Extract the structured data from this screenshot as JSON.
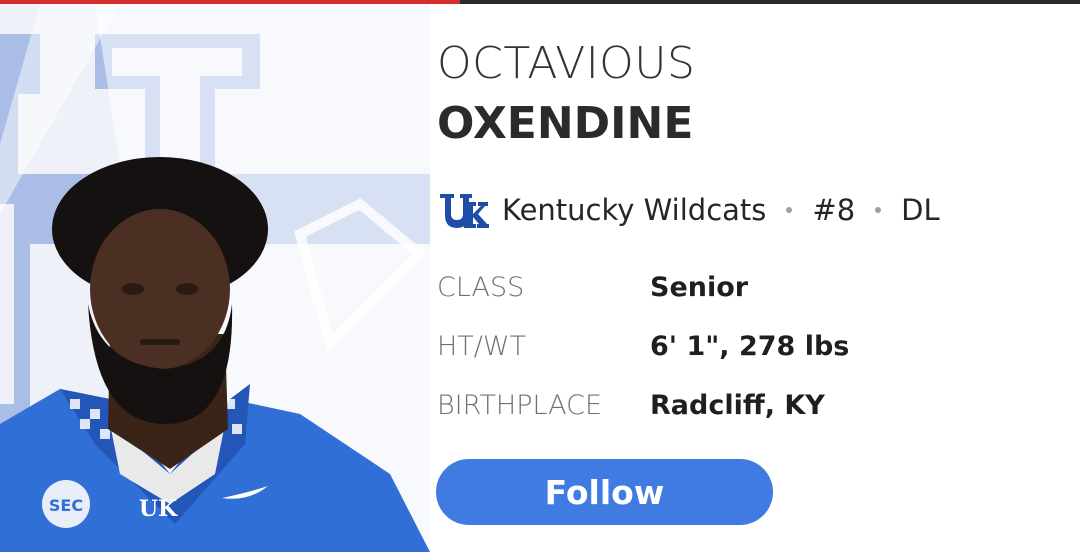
{
  "player": {
    "first_name": "OCTAVIOUS",
    "last_name": "OXENDINE"
  },
  "team": {
    "logo_icon": "uk-logo-icon",
    "name": "Kentucky Wildcats",
    "number": "#8",
    "position": "DL"
  },
  "info": [
    {
      "label": "CLASS",
      "value": "Senior"
    },
    {
      "label": "HT/WT",
      "value": "6' 1\", 278 lbs"
    },
    {
      "label": "BIRTHPLACE",
      "value": "Radcliff, KY"
    }
  ],
  "actions": {
    "follow_label": "Follow"
  },
  "colors": {
    "accent": "#3f7be0",
    "brand_blue": "#1f4ea8",
    "top_bar_red": "#d32f2f"
  }
}
